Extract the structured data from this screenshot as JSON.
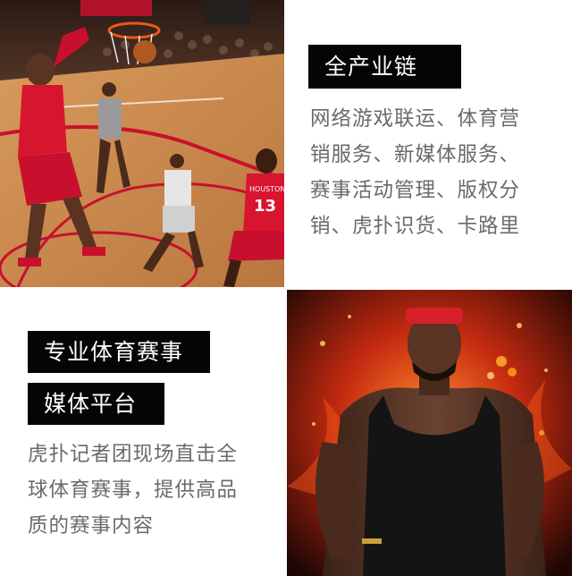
{
  "panels": {
    "top_right": {
      "heading": "全产业链",
      "lines": [
        "网络游戏联运、体育营",
        "销服务、新媒体服务、",
        "赛事活动管理、版权分",
        "销、虎扑识货、卡路里"
      ]
    },
    "bottom_left": {
      "heading_1": "专业体育赛事",
      "heading_2": "媒体平台",
      "lines": [
        "虎扑记者团现场直击全",
        "球体育赛事，提供高品",
        "质的赛事内容"
      ]
    },
    "top_left_photo": {
      "jersey_text": "HOUSTON",
      "jersey_number": "13"
    }
  },
  "colors": {
    "label_bg": "#050505",
    "desc_text": "#6a6a6a",
    "rockets_red": "#c8102e",
    "court_wood": "#c98a4e"
  }
}
